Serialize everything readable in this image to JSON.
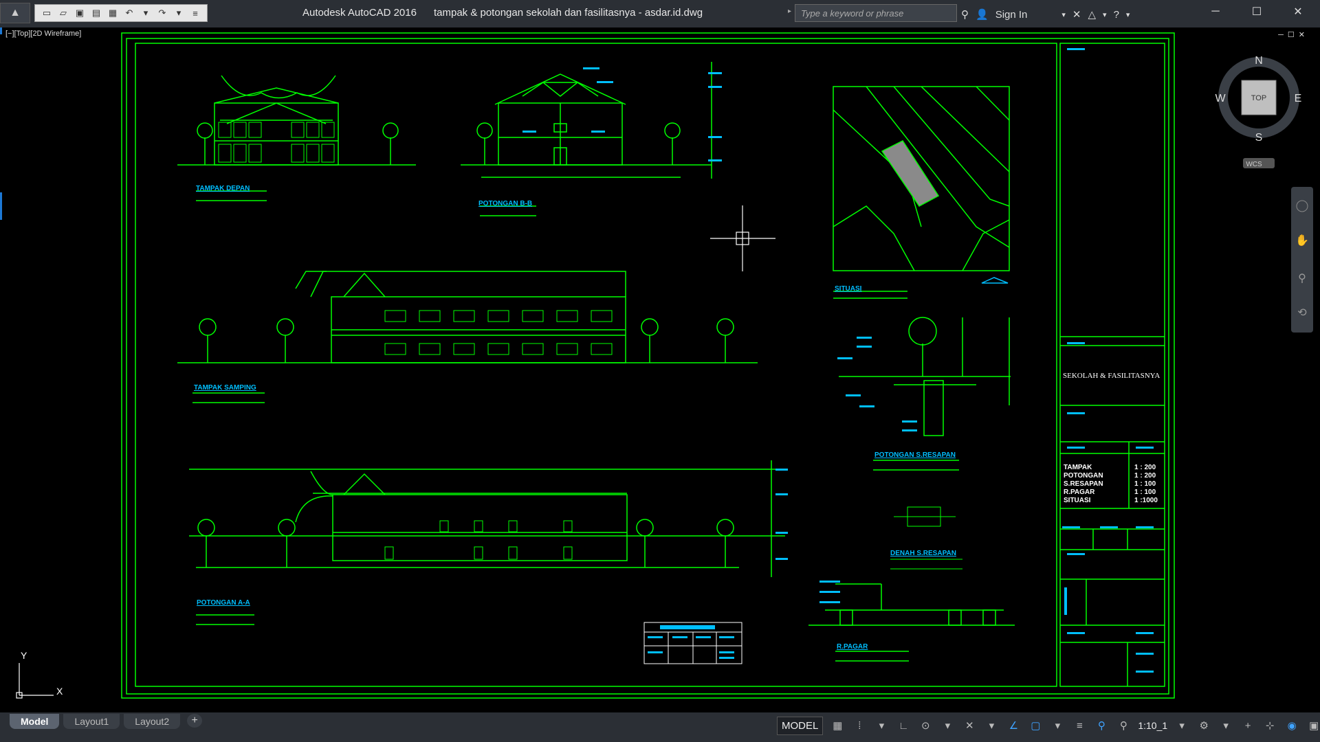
{
  "app": {
    "title": "Autodesk AutoCAD 2016",
    "filename": "tampak & potongan sekolah dan fasilitasnya - asdar.id.dwg",
    "search_placeholder": "Type a keyword or phrase",
    "sign_in": "Sign In"
  },
  "viewport": {
    "label": "[−][Top][2D Wireframe]"
  },
  "viewcube": {
    "north": "N",
    "south": "S",
    "east": "E",
    "west": "W",
    "face": "TOP",
    "ucs": "WCS"
  },
  "axes": {
    "x": "X",
    "y": "Y"
  },
  "drawing": {
    "labels": {
      "tampak_depan": "TAMPAK DEPAN",
      "potongan_bb": "POTONGAN B-B",
      "situasi": "SITUASI",
      "tampak_samping": "TAMPAK SAMPING",
      "potongan_resapan": "POTONGAN S.RESAPAN",
      "potongan_aa": "POTONGAN A-A",
      "denah_resapan": "DENAH S.RESAPAN",
      "pagar": "R.PAGAR"
    },
    "title_block": {
      "project": "SEKOLAH & FASILITASNYA",
      "scales": [
        {
          "name": "TAMPAK",
          "value": "1 : 200"
        },
        {
          "name": "POTONGAN",
          "value": "1 : 200"
        },
        {
          "name": "S.RESAPAN",
          "value": "1 : 100"
        },
        {
          "name": "R.PAGAR",
          "value": "1 : 100"
        },
        {
          "name": "SITUASI",
          "value": "1 :1000"
        }
      ]
    }
  },
  "tabs": [
    {
      "label": "Model",
      "active": true
    },
    {
      "label": "Layout1",
      "active": false
    },
    {
      "label": "Layout2",
      "active": false
    }
  ],
  "status": {
    "model": "MODEL",
    "annotation_scale": "1:10_1"
  },
  "colors": {
    "line": "#00ff00",
    "annotation": "#00bfff",
    "background": "#000000",
    "ui": "#2b2f35"
  }
}
